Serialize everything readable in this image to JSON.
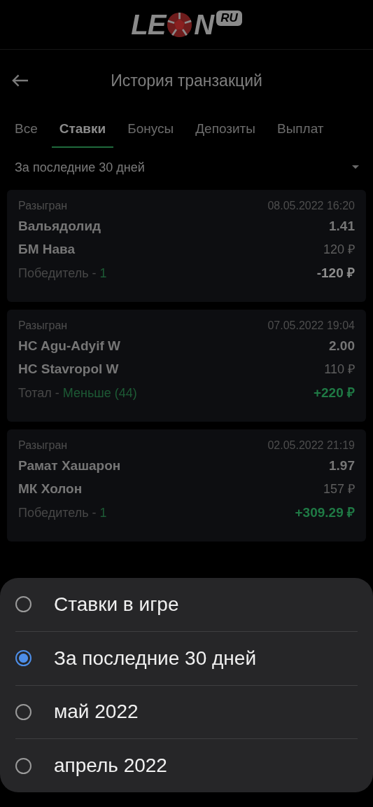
{
  "logo": {
    "left": "LE",
    "right": "N",
    "badge": "RU"
  },
  "title": "История транзакций",
  "tabs": [
    {
      "label": "Все",
      "selected": false
    },
    {
      "label": "Ставки",
      "selected": true
    },
    {
      "label": "Бонусы",
      "selected": false
    },
    {
      "label": "Депозиты",
      "selected": false
    },
    {
      "label": "Выплат",
      "selected": false
    }
  ],
  "filter": "За последние 30 дней",
  "bets": [
    {
      "status": "Разыгран",
      "date": "08.05.2022 16:20",
      "team_1": "Вальядолид",
      "odds": "1.41",
      "team_2": "БМ Нава",
      "stake": "120 ₽",
      "market": "Победитель - ",
      "pick": "1",
      "result": "-120 ₽",
      "kind": "loss"
    },
    {
      "status": "Разыгран",
      "date": "07.05.2022 19:04",
      "team_1": "HC Agu-Adyif W",
      "odds": "2.00",
      "team_2": "HC Stavropol W",
      "stake": "110 ₽",
      "market": "Тотал - ",
      "pick": "Меньше (44)",
      "result": "+220 ₽",
      "kind": "win"
    },
    {
      "status": "Разыгран",
      "date": "02.05.2022 21:19",
      "team_1": "Рамат Хашарон",
      "odds": "1.97",
      "team_2": "МК Холон",
      "stake": "157 ₽",
      "market": "Победитель - ",
      "pick": "1",
      "result": "+309.29 ₽",
      "kind": "win"
    }
  ],
  "options": [
    {
      "label": "Ставки в игре",
      "selected": false
    },
    {
      "label": "За последние 30 дней",
      "selected": true
    },
    {
      "label": "май 2022",
      "selected": false
    },
    {
      "label": "апрель 2022",
      "selected": false
    }
  ]
}
